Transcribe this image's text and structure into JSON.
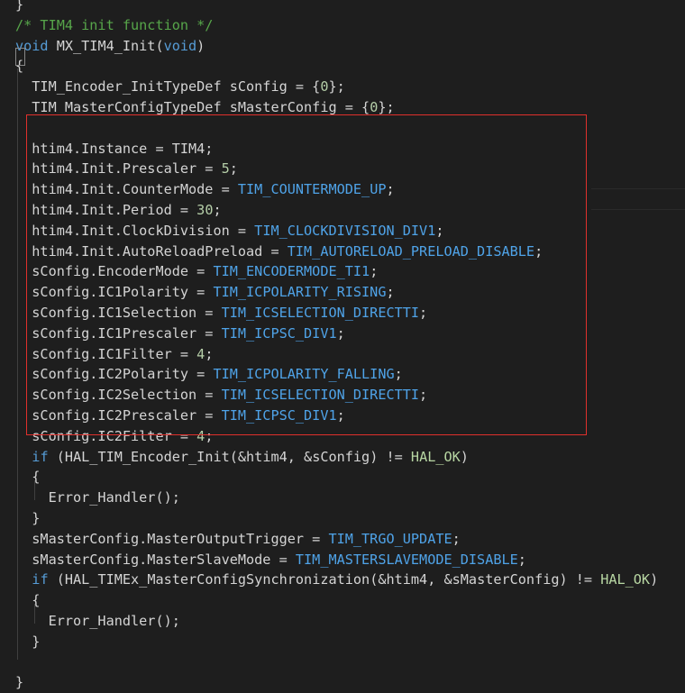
{
  "colors": {
    "background": "#1e1e1e",
    "text": "#d4d4d4",
    "comment": "#57a64a",
    "keyword": "#569cd6",
    "number": "#b5cea8",
    "macro": "#4fa3e8",
    "highlight_box": "#e0302c"
  },
  "code_lines": [
    [
      {
        "t": "}",
        "c": "plain"
      }
    ],
    [
      {
        "t": "/* TIM4 init function */",
        "c": "comment"
      }
    ],
    [
      {
        "t": "void",
        "c": "keyword"
      },
      {
        "t": " MX_TIM4_Init(",
        "c": "plain"
      },
      {
        "t": "void",
        "c": "keyword"
      },
      {
        "t": ")",
        "c": "plain"
      }
    ],
    [
      {
        "t": "{",
        "c": "plain"
      }
    ],
    [
      {
        "t": "  TIM_Encoder_InitTypeDef sConfig = {",
        "c": "plain"
      },
      {
        "t": "0",
        "c": "number"
      },
      {
        "t": "};",
        "c": "plain"
      }
    ],
    [
      {
        "t": "  TIM_MasterConfigTypeDef sMasterConfig = {",
        "c": "plain"
      },
      {
        "t": "0",
        "c": "number"
      },
      {
        "t": "};",
        "c": "plain"
      }
    ],
    [
      {
        "t": "",
        "c": "plain"
      }
    ],
    [
      {
        "t": "  htim4.Instance = TIM4;",
        "c": "plain"
      }
    ],
    [
      {
        "t": "  htim4.Init.Prescaler = ",
        "c": "plain"
      },
      {
        "t": "5",
        "c": "number"
      },
      {
        "t": ";",
        "c": "plain"
      }
    ],
    [
      {
        "t": "  htim4.Init.CounterMode = ",
        "c": "plain"
      },
      {
        "t": "TIM_COUNTERMODE_UP",
        "c": "macro"
      },
      {
        "t": ";",
        "c": "plain"
      }
    ],
    [
      {
        "t": "  htim4.Init.Period = ",
        "c": "plain"
      },
      {
        "t": "30",
        "c": "number"
      },
      {
        "t": ";",
        "c": "plain"
      }
    ],
    [
      {
        "t": "  htim4.Init.ClockDivision = ",
        "c": "plain"
      },
      {
        "t": "TIM_CLOCKDIVISION_DIV1",
        "c": "macro"
      },
      {
        "t": ";",
        "c": "plain"
      }
    ],
    [
      {
        "t": "  htim4.Init.AutoReloadPreload = ",
        "c": "plain"
      },
      {
        "t": "TIM_AUTORELOAD_PRELOAD_DISABLE",
        "c": "macro"
      },
      {
        "t": ";",
        "c": "plain"
      }
    ],
    [
      {
        "t": "  sConfig.EncoderMode = ",
        "c": "plain"
      },
      {
        "t": "TIM_ENCODERMODE_TI1",
        "c": "macro"
      },
      {
        "t": ";",
        "c": "plain"
      }
    ],
    [
      {
        "t": "  sConfig.IC1Polarity = ",
        "c": "plain"
      },
      {
        "t": "TIM_ICPOLARITY_RISING",
        "c": "macro"
      },
      {
        "t": ";",
        "c": "plain"
      }
    ],
    [
      {
        "t": "  sConfig.IC1Selection = ",
        "c": "plain"
      },
      {
        "t": "TIM_ICSELECTION_DIRECTTI",
        "c": "macro"
      },
      {
        "t": ";",
        "c": "plain"
      }
    ],
    [
      {
        "t": "  sConfig.IC1Prescaler = ",
        "c": "plain"
      },
      {
        "t": "TIM_ICPSC_DIV1",
        "c": "macro"
      },
      {
        "t": ";",
        "c": "plain"
      }
    ],
    [
      {
        "t": "  sConfig.IC1Filter = ",
        "c": "plain"
      },
      {
        "t": "4",
        "c": "number"
      },
      {
        "t": ";",
        "c": "plain"
      }
    ],
    [
      {
        "t": "  sConfig.IC2Polarity = ",
        "c": "plain"
      },
      {
        "t": "TIM_ICPOLARITY_FALLING",
        "c": "macro"
      },
      {
        "t": ";",
        "c": "plain"
      }
    ],
    [
      {
        "t": "  sConfig.IC2Selection = ",
        "c": "plain"
      },
      {
        "t": "TIM_ICSELECTION_DIRECTTI",
        "c": "macro"
      },
      {
        "t": ";",
        "c": "plain"
      }
    ],
    [
      {
        "t": "  sConfig.IC2Prescaler = ",
        "c": "plain"
      },
      {
        "t": "TIM_ICPSC_DIV1",
        "c": "macro"
      },
      {
        "t": ";",
        "c": "plain"
      }
    ],
    [
      {
        "t": "  sConfig.IC2Filter = ",
        "c": "plain"
      },
      {
        "t": "4",
        "c": "number"
      },
      {
        "t": ";",
        "c": "plain"
      }
    ],
    [
      {
        "t": "  ",
        "c": "plain"
      },
      {
        "t": "if",
        "c": "keyword"
      },
      {
        "t": " (HAL_TIM_Encoder_Init(&htim4, &sConfig) != ",
        "c": "plain"
      },
      {
        "t": "HAL_OK",
        "c": "halok"
      },
      {
        "t": ")",
        "c": "plain"
      }
    ],
    [
      {
        "t": "  {",
        "c": "plain"
      }
    ],
    [
      {
        "t": "    Error_Handler();",
        "c": "plain"
      }
    ],
    [
      {
        "t": "  }",
        "c": "plain"
      }
    ],
    [
      {
        "t": "  sMasterConfig.MasterOutputTrigger = ",
        "c": "plain"
      },
      {
        "t": "TIM_TRGO_UPDATE",
        "c": "macro"
      },
      {
        "t": ";",
        "c": "plain"
      }
    ],
    [
      {
        "t": "  sMasterConfig.MasterSlaveMode = ",
        "c": "plain"
      },
      {
        "t": "TIM_MASTERSLAVEMODE_DISABLE",
        "c": "macro"
      },
      {
        "t": ";",
        "c": "plain"
      }
    ],
    [
      {
        "t": "  ",
        "c": "plain"
      },
      {
        "t": "if",
        "c": "keyword"
      },
      {
        "t": " (HAL_TIMEx_MasterConfigSynchronization(&htim4, &sMasterConfig) != ",
        "c": "plain"
      },
      {
        "t": "HAL_OK",
        "c": "halok"
      },
      {
        "t": ")",
        "c": "plain"
      }
    ],
    [
      {
        "t": "  {",
        "c": "plain"
      }
    ],
    [
      {
        "t": "    Error_Handler();",
        "c": "plain"
      }
    ],
    [
      {
        "t": "  }",
        "c": "plain"
      }
    ],
    [
      {
        "t": "",
        "c": "plain"
      }
    ],
    [
      {
        "t": "}",
        "c": "plain"
      }
    ]
  ]
}
